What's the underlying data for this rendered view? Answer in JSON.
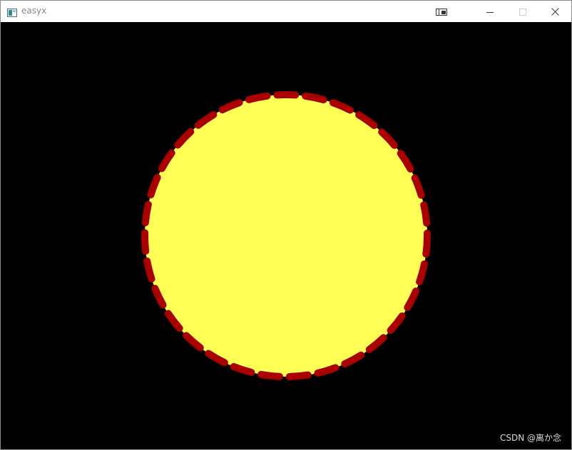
{
  "window": {
    "title": "easyx",
    "icons": {
      "app": "app-window-icon",
      "pip": "picture-in-picture-icon",
      "minimize": "minimize-icon",
      "maximize": "maximize-icon",
      "close": "close-icon"
    }
  },
  "canvas": {
    "background_color": "#000000",
    "circle": {
      "fill_color": "#ffff55",
      "stroke_color": "#aa0000",
      "stroke_style": "dashed"
    }
  },
  "watermark": {
    "text": "CSDN @离か念"
  }
}
